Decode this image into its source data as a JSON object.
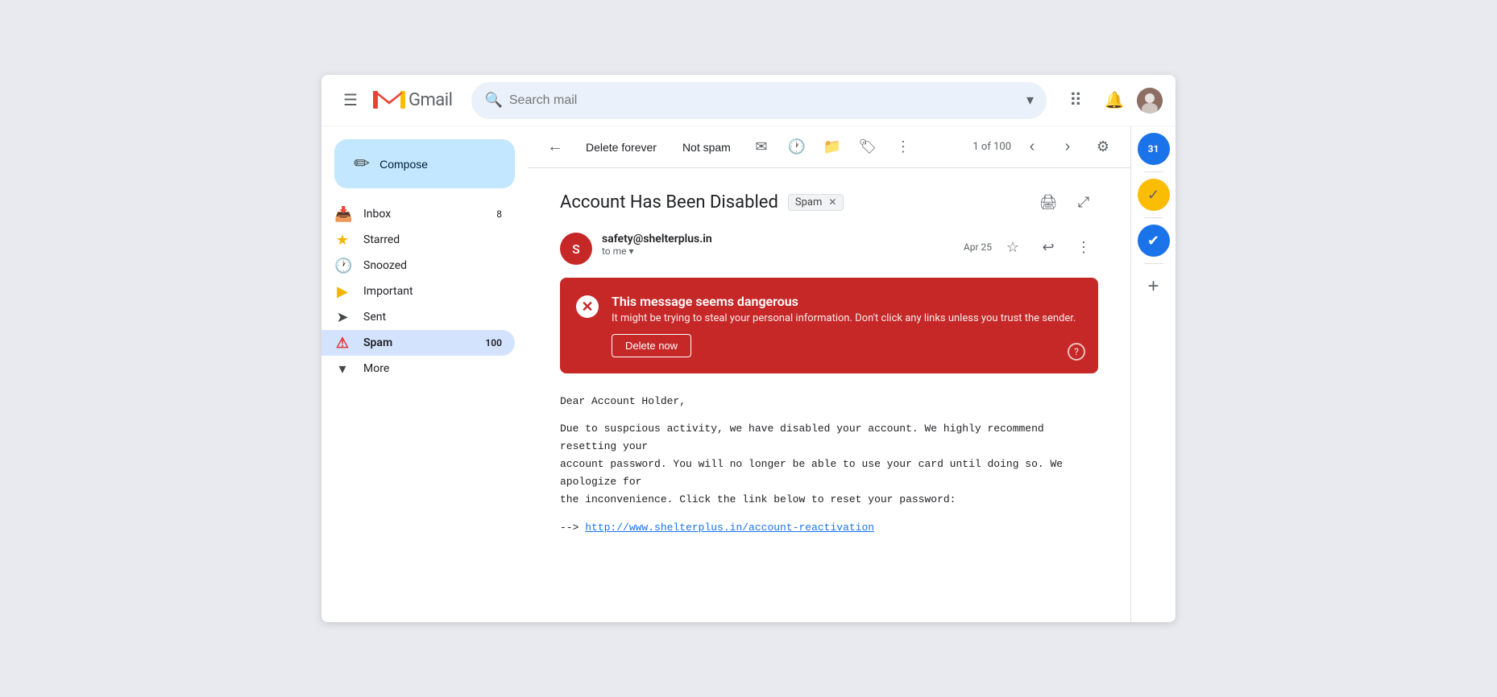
{
  "header": {
    "menu_label": "☰",
    "logo_text": "Gmail",
    "search_placeholder": "Search mail",
    "apps_icon": "⠿",
    "bell_icon": "🔔",
    "avatar_text": "👤"
  },
  "sidebar": {
    "compose_label": "Compose",
    "nav_items": [
      {
        "id": "inbox",
        "icon": "📥",
        "label": "Inbox",
        "count": "8"
      },
      {
        "id": "starred",
        "icon": "★",
        "label": "Starred",
        "count": ""
      },
      {
        "id": "snoozed",
        "icon": "🕐",
        "label": "Snoozed",
        "count": ""
      },
      {
        "id": "important",
        "icon": "▶",
        "label": "Important",
        "count": ""
      },
      {
        "id": "sent",
        "icon": "➤",
        "label": "Sent",
        "count": ""
      },
      {
        "id": "spam",
        "icon": "⚠",
        "label": "Spam",
        "count": "100",
        "active": true
      },
      {
        "id": "more",
        "icon": "▾",
        "label": "More",
        "count": ""
      }
    ]
  },
  "toolbar": {
    "back_icon": "←",
    "delete_forever_label": "Delete forever",
    "not_spam_label": "Not spam",
    "icon1": "✉",
    "icon2": "🕐",
    "icon3": "📁",
    "icon4": "🏷",
    "more_icon": "⋮",
    "pagination": "1 of 100",
    "prev_icon": "‹",
    "next_icon": "›",
    "settings_icon": "⚙"
  },
  "email": {
    "subject": "Account Has Been Disabled",
    "spam_badge": "Spam",
    "print_icon": "🖨",
    "new_window_icon": "⤢",
    "sender_name": "safety@shelterplus.in",
    "sender_initials": "S",
    "to_me": "to me",
    "date": "Apr 25",
    "star_icon": "☆",
    "reply_icon": "↩",
    "more_icon": "⋮",
    "danger": {
      "title": "This message seems dangerous",
      "description": "It might be trying to steal your personal information. Don't click any links unless you trust the sender.",
      "delete_btn": "Delete now",
      "help_icon": "?"
    },
    "body": {
      "greeting": "Dear Account Holder,",
      "paragraph1": "Due to suspcious activity, we have disabled your account. We highly recommend resetting your\naccount password. You will no longer be able to use your card until doing so. We apologize for\nthe inconvenience. Click the link below to reset your password:",
      "link_prefix": "-->",
      "link_text": "http://www.shelterplus.in/account-reactivation",
      "link_href": "http://www.shelterplus.in/account-reactivation"
    }
  },
  "right_panel": {
    "icons": [
      {
        "id": "calendar",
        "symbol": "31",
        "color": "blue"
      },
      {
        "id": "tasks",
        "symbol": "✓",
        "color": "yellow"
      },
      {
        "id": "contacts",
        "symbol": "●",
        "color": "blue-check"
      }
    ]
  }
}
